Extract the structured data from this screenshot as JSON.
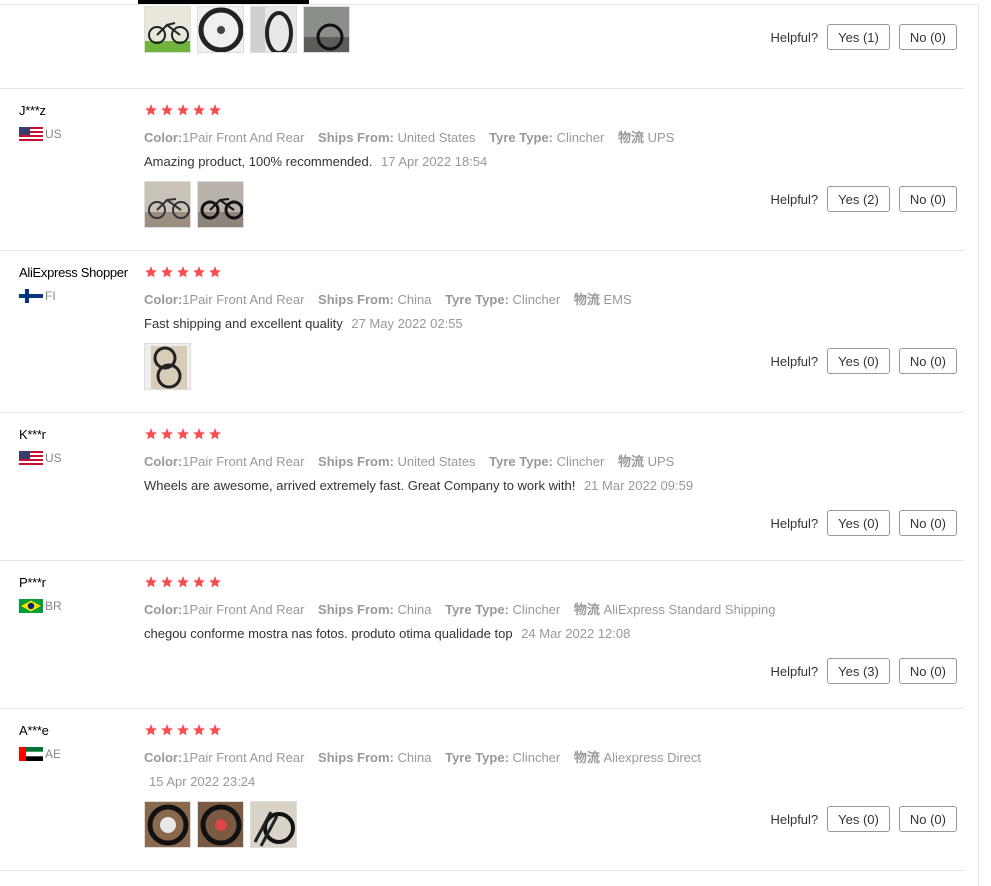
{
  "helpful_label": "Helpful?",
  "colors": {
    "star": "#f44e4e",
    "meta_gray": "#999999",
    "divider": "#e5e5e5"
  },
  "prop_labels": {
    "color": "Color:",
    "ships": "Ships From:",
    "tyre": "Tyre Type:",
    "logistics": "物流"
  },
  "reviews": [
    {
      "helpful_yes": "Yes (1)",
      "helpful_no": "No (0)"
    },
    {
      "user": "J***z",
      "country": "US",
      "stars": 5,
      "color": "1Pair Front And Rear",
      "ships": "United States",
      "tyre": "Clincher",
      "logistics": "UPS",
      "text": "Amazing product, 100% recommended.",
      "date": "17 Apr 2022 18:54",
      "helpful_yes": "Yes (2)",
      "helpful_no": "No (0)"
    },
    {
      "user": "AliExpress Shopper",
      "country": "FI",
      "stars": 5,
      "color": "1Pair Front And Rear",
      "ships": "China",
      "tyre": "Clincher",
      "logistics": "EMS",
      "text": "Fast shipping and excellent quality",
      "date": "27 May 2022 02:55",
      "helpful_yes": "Yes (0)",
      "helpful_no": "No (0)"
    },
    {
      "user": "K***r",
      "country": "US",
      "stars": 5,
      "color": "1Pair Front And Rear",
      "ships": "United States",
      "tyre": "Clincher",
      "logistics": "UPS",
      "text": "Wheels are awesome, arrived extremely fast. Great Company to work with!",
      "date": "21 Mar 2022 09:59",
      "helpful_yes": "Yes (0)",
      "helpful_no": "No (0)"
    },
    {
      "user": "P***r",
      "country": "BR",
      "stars": 5,
      "color": "1Pair Front And Rear",
      "ships": "China",
      "tyre": "Clincher",
      "logistics": "AliExpress Standard Shipping",
      "text": "chegou conforme mostra nas fotos. produto otima qualidade top",
      "date": "24 Mar 2022 12:08",
      "helpful_yes": "Yes (3)",
      "helpful_no": "No (0)"
    },
    {
      "user": "A***e",
      "country": "AE",
      "stars": 5,
      "color": "1Pair Front And Rear",
      "ships": "China",
      "tyre": "Clincher",
      "logistics": "Aliexpress Direct",
      "text": "",
      "date": "15 Apr 2022 23:24",
      "helpful_yes": "Yes (0)",
      "helpful_no": "No (0)"
    }
  ]
}
